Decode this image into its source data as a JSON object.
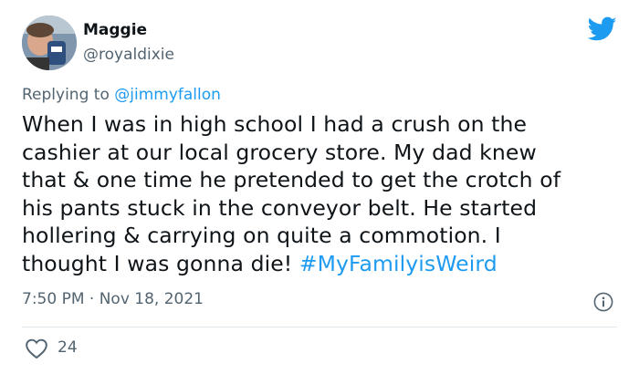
{
  "author": {
    "name": "Maggie",
    "handle": "@royaldixie"
  },
  "reply": {
    "prefix": "Replying to ",
    "mention": "@jimmyfallon"
  },
  "tweet": {
    "lines": [
      "When I was in high school I had a crush on the",
      "cashier at our local grocery store. My dad knew",
      "that & one time he pretended to get the crotch of",
      "his pants stuck in the conveyor belt. He started",
      "hollering & carrying on quite a commotion. I",
      "thought I was gonna die! "
    ],
    "hashtag": "#MyFamilyisWeird"
  },
  "meta": {
    "timestamp": "7:50 PM · Nov 18, 2021"
  },
  "engagement": {
    "likes": "24"
  },
  "colors": {
    "accent": "#1d9bf0",
    "secondary_text": "#536471"
  },
  "icons": [
    "twitter-bird-icon",
    "info-icon",
    "heart-icon"
  ]
}
